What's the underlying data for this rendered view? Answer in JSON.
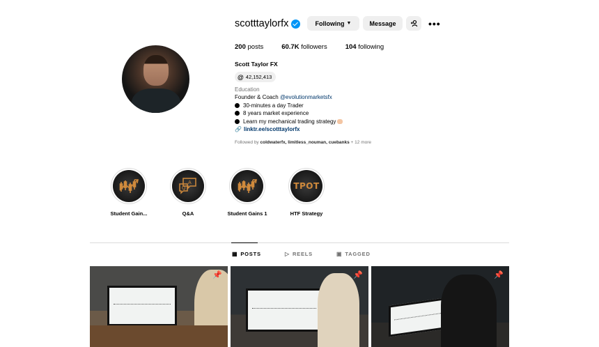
{
  "profile": {
    "username": "scotttaylorfx",
    "verified": true,
    "buttons": {
      "following": "Following",
      "message": "Message"
    },
    "stats": {
      "posts": "200",
      "posts_label": "posts",
      "followers": "60.7K",
      "followers_label": "followers",
      "following": "104",
      "following_label": "following"
    },
    "full_name": "Scott Taylor FX",
    "threads_count": "42,152,413",
    "category": "Education",
    "bio": {
      "line1_prefix": "Founder & Coach ",
      "line1_mention": "@evolutionmarketsfx",
      "bullet1": "30-minutes a day Trader",
      "bullet2": "8 years market experience",
      "bullet3": "Learn my mechanical trading strategy",
      "link": "linktr.ee/scotttaylorfx"
    },
    "followed_by": {
      "prefix": "Followed by ",
      "names": "coldwaterfx, limitless_nouman, cuebanks",
      "suffix": " + 12 more"
    }
  },
  "highlights": [
    {
      "label": "Student Gain...",
      "icon": "trading-chart-icon"
    },
    {
      "label": "Q&A",
      "icon": "qa-chat-icon"
    },
    {
      "label": "Student Gains 1",
      "icon": "trading-chart-icon"
    },
    {
      "label": "HTF Strategy",
      "icon": "tpot-text",
      "text": "TPOT"
    }
  ],
  "tabs": [
    {
      "label": "POSTS",
      "icon": "grid-icon",
      "active": true
    },
    {
      "label": "REELS",
      "icon": "reels-icon",
      "active": false
    },
    {
      "label": "TAGGED",
      "icon": "tagged-icon",
      "active": false
    }
  ],
  "posts": [
    {
      "pinned": true,
      "icon": "pin-icon"
    },
    {
      "pinned": true,
      "icon": "pin-icon"
    },
    {
      "pinned": true,
      "icon": "pin-icon"
    }
  ],
  "colors": {
    "verified": "#0095f6",
    "link": "#00376b",
    "secondary_text": "#737373",
    "button_bg": "#efefef",
    "highlight_accent": "#d08a3c"
  }
}
